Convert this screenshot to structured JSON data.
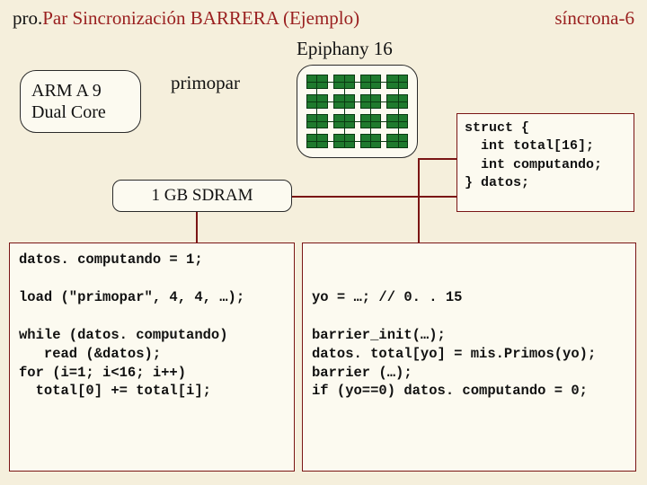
{
  "header": {
    "left_black": "pro.",
    "left_red": "Par Sincronización BARRERA (Ejemplo)",
    "right": "síncrona-6"
  },
  "labels": {
    "epiphany": "Epiphany 16",
    "primopar": "primopar",
    "sdram": "1 GB SDRAM",
    "arm_line1": "ARM A 9",
    "arm_line2": "Dual Core"
  },
  "struct_code": "struct {\n  int total[16];\n  int computando;\n} datos;",
  "code_left": "datos. computando = 1;\n\nload (\"primopar\", 4, 4, …);\n\nwhile (datos. computando)\n   read (&datos);\nfor (i=1; i<16; i++)\n  total[0] += total[i];",
  "code_right": "\n\nyo = …; // 0. . 15\n\nbarrier_init(…);\ndatos. total[yo] = mis.Primos(yo);\nbarrier (…);\nif (yo==0) datos. computando = 0;"
}
